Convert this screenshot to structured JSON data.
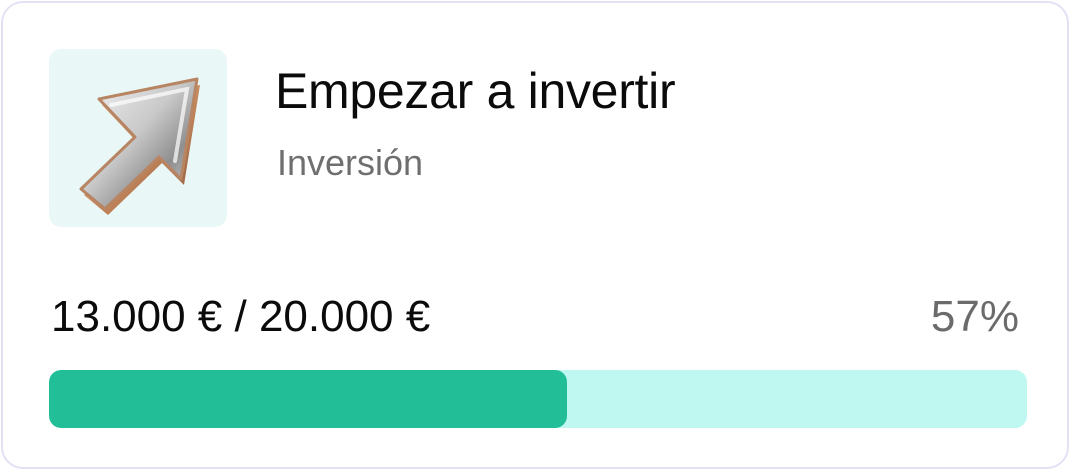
{
  "card": {
    "icon": "arrow-up-right-icon",
    "title": "Empezar a invertir",
    "category": "Inversión",
    "amount_text": "13.000 € / 20.000 €",
    "percent_text": "57%",
    "progress": {
      "current": 13000,
      "target": 20000,
      "fraction": 0.53
    }
  },
  "colors": {
    "progress_fill": "#22be98",
    "progress_track": "#bff7f1",
    "icon_background": "#e9f8f7",
    "card_border": "#e3e1f4"
  }
}
